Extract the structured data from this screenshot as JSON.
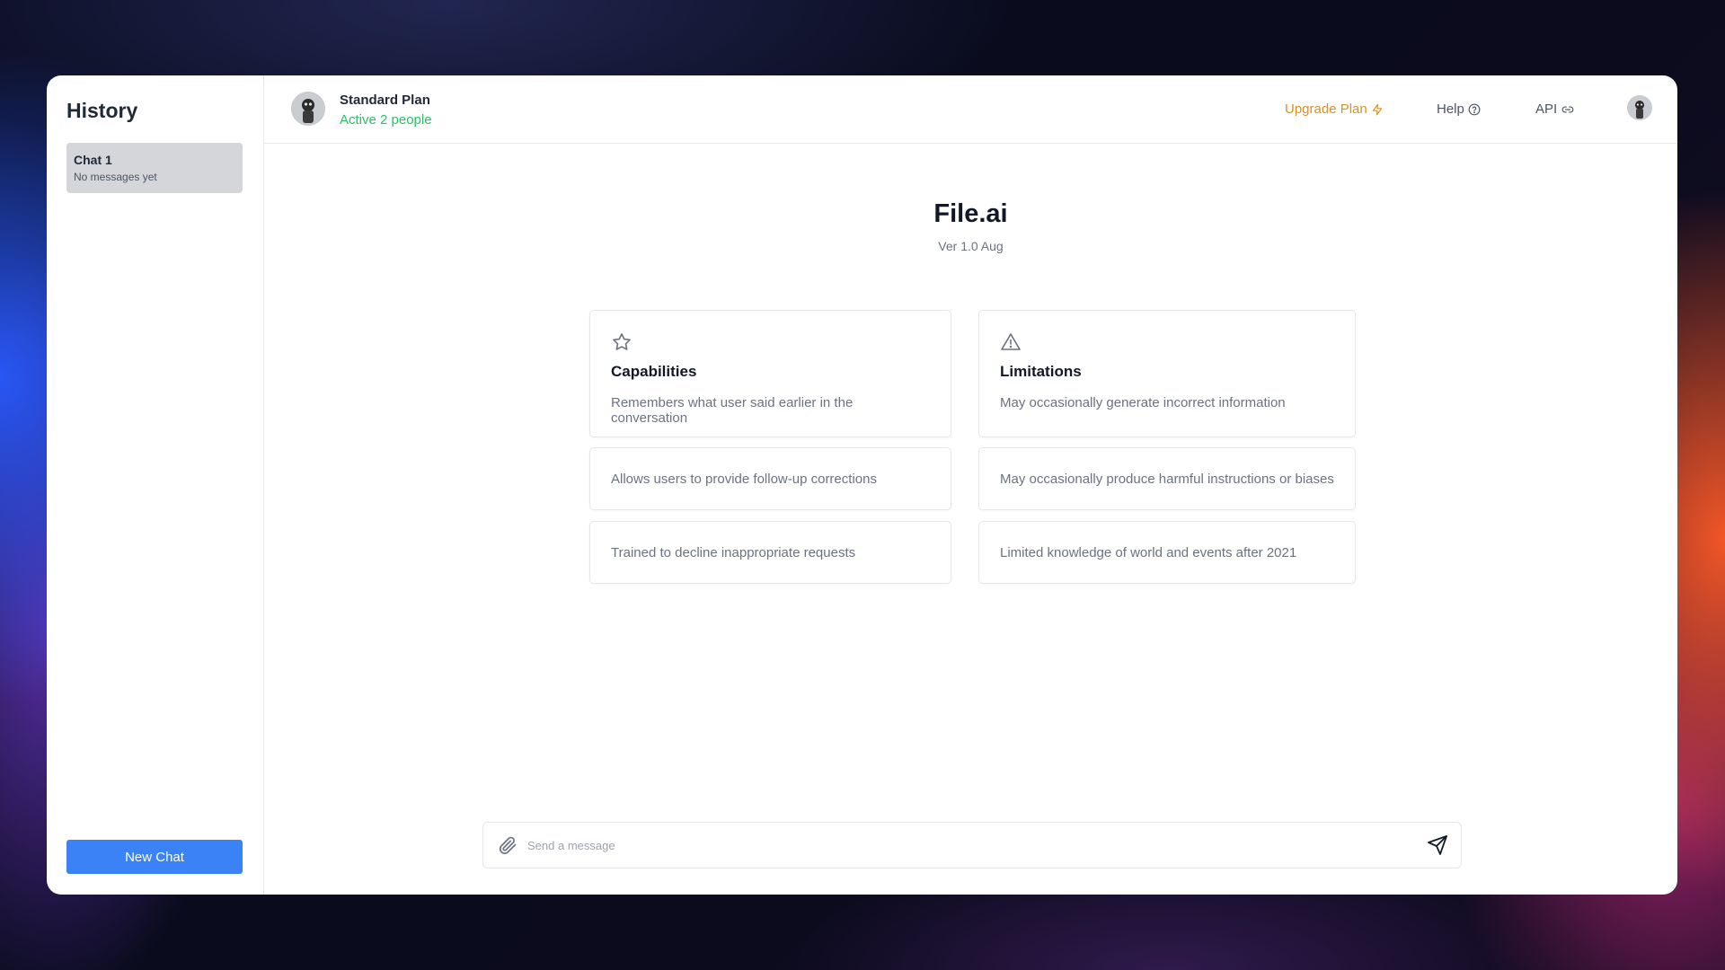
{
  "sidebar": {
    "title": "History",
    "chats": [
      {
        "title": "Chat 1",
        "subtitle": "No messages yet"
      }
    ],
    "new_chat_label": "New Chat"
  },
  "header": {
    "plan_name": "Standard Plan",
    "plan_status": "Active 2 people",
    "links": {
      "upgrade": "Upgrade Plan",
      "help": "Help",
      "api": "API"
    }
  },
  "hero": {
    "title": "File.ai",
    "version": "Ver 1.0 Aug"
  },
  "capabilities": {
    "icon": "star-icon",
    "heading": "Capabilities",
    "items": [
      "Remembers what user said earlier in the conversation",
      "Allows users to provide follow-up corrections",
      "Trained to decline inappropriate requests"
    ]
  },
  "limitations": {
    "icon": "warning-icon",
    "heading": "Limitations",
    "items": [
      "May occasionally generate incorrect information",
      "May occasionally produce harmful instructions or biases",
      "Limited knowledge of world and events after 2021"
    ]
  },
  "composer": {
    "placeholder": "Send a message",
    "attach_icon": "paperclip-icon",
    "send_icon": "send-icon"
  },
  "colors": {
    "accent": "#3b82f6",
    "upgrade": "#d9931c",
    "active": "#22c55e"
  }
}
